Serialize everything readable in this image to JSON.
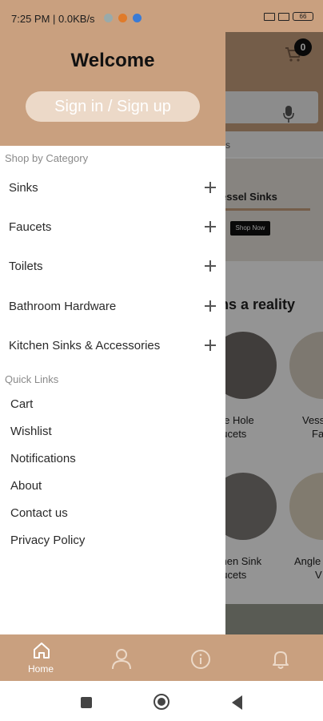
{
  "status_bar": {
    "time": "7:25 PM",
    "speed": "0.0KB/s",
    "battery": "66"
  },
  "background": {
    "cart_count": "0",
    "tab_fragment": "s",
    "banner_title": "essel Sinks",
    "banner_button": "Shop Now",
    "heading": "ms a reality",
    "products": [
      {
        "line1": "gle Hole",
        "line2": "aucets"
      },
      {
        "line1": "Vess",
        "line2": "Fa"
      },
      {
        "line1": "chen Sink",
        "line2": "aucets"
      },
      {
        "line1": "Angle",
        "line2": "V"
      }
    ]
  },
  "drawer": {
    "welcome": "Welcome",
    "signin_label": "Sign in / Sign up",
    "shop_by_category_title": "Shop by Category",
    "categories": [
      {
        "label": "Sinks"
      },
      {
        "label": "Faucets"
      },
      {
        "label": "Toilets"
      },
      {
        "label": "Bathroom Hardware"
      },
      {
        "label": "Kitchen Sinks & Accessories"
      }
    ],
    "quick_links_title": "Quick Links",
    "quick_links": [
      {
        "label": "Cart"
      },
      {
        "label": "Wishlist"
      },
      {
        "label": "Notifications"
      },
      {
        "label": "About"
      },
      {
        "label": "Contact us"
      },
      {
        "label": "Privacy Policy"
      }
    ]
  },
  "bottom_nav": {
    "items": [
      {
        "label": "Home",
        "icon": "home-icon"
      },
      {
        "label": "",
        "icon": "profile-icon"
      },
      {
        "label": "",
        "icon": "info-icon"
      },
      {
        "label": "",
        "icon": "bell-icon"
      }
    ]
  },
  "colors": {
    "brand": "#c9a07f",
    "signin_bg": "#ecd9c8"
  }
}
